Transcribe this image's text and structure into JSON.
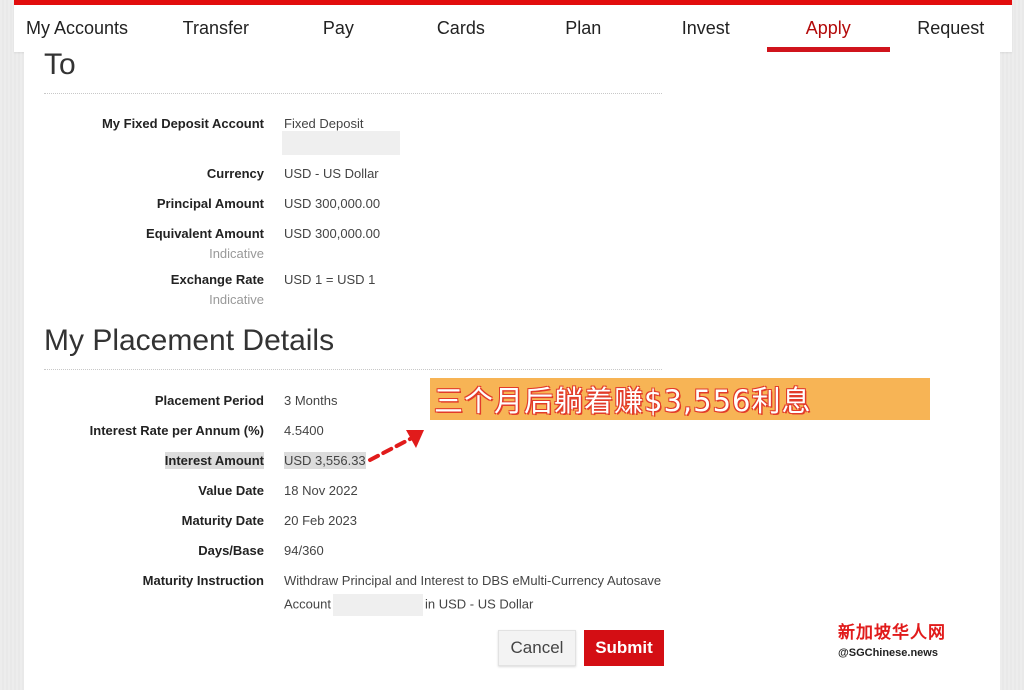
{
  "nav": {
    "items": [
      {
        "label": "My Accounts"
      },
      {
        "label": "Transfer"
      },
      {
        "label": "Pay"
      },
      {
        "label": "Cards"
      },
      {
        "label": "Plan"
      },
      {
        "label": "Invest"
      },
      {
        "label": "Apply"
      },
      {
        "label": "Request"
      }
    ],
    "active": "Apply"
  },
  "to_section": {
    "title": "To",
    "rows": [
      {
        "label": "My Fixed Deposit Account",
        "value": "Fixed Deposit"
      },
      {
        "label": "Currency",
        "value": "USD - US Dollar"
      },
      {
        "label": "Principal Amount",
        "value": "USD 300,000.00"
      },
      {
        "label": "Equivalent Amount",
        "sub": "Indicative",
        "value": "USD 300,000.00"
      },
      {
        "label": "Exchange Rate",
        "sub": "Indicative",
        "value": "USD 1 = USD 1"
      }
    ]
  },
  "placement_section": {
    "title": "My Placement Details",
    "rows": [
      {
        "label": "Placement Period",
        "value": "3 Months"
      },
      {
        "label": "Interest Rate per Annum (%)",
        "value": "4.5400"
      },
      {
        "label": "Interest Amount",
        "value": "USD 3,556.33"
      },
      {
        "label": "Value Date",
        "value": "18 Nov 2022"
      },
      {
        "label": "Maturity Date",
        "value": "20 Feb 2023"
      },
      {
        "label": "Days/Base",
        "value": "94/360"
      },
      {
        "label": "Maturity Instruction",
        "value_line1": "Withdraw Principal and Interest to DBS eMulti-Currency Autosave",
        "value_line2_pre": "Account",
        "value_line2_post": "in USD - US Dollar"
      }
    ]
  },
  "buttons": {
    "cancel": "Cancel",
    "submit": "Submit"
  },
  "annotation": {
    "text": "三个月后躺着赚$3,556利息"
  },
  "watermark": {
    "cn": "新加坡华人网",
    "en": "@SGChinese.news"
  },
  "colors": {
    "accent": "#d0141c",
    "annotation_bg": "#f7b455",
    "annotation_stroke": "#e23b2a"
  }
}
